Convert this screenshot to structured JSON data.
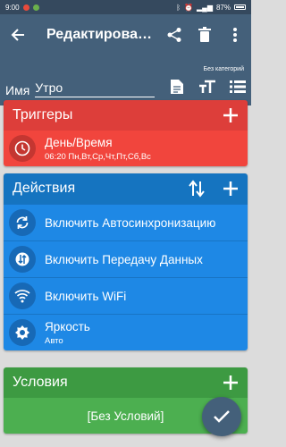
{
  "status": {
    "time": "9:00",
    "battery": "87%"
  },
  "toolbar": {
    "title": "Редактировать макрос"
  },
  "header": {
    "name_label": "Имя",
    "name_value": "Утро",
    "category_label": "Без категорий"
  },
  "triggers": {
    "title": "Триггеры",
    "items": [
      {
        "title": "День/Время",
        "subtitle": "06:20 Пн,Вт,Ср,Чт,Пт,Сб,Вс",
        "icon": "clock-icon"
      }
    ]
  },
  "actions": {
    "title": "Действия",
    "items": [
      {
        "title": "Включить Автосинхронизацию",
        "icon": "sync-icon"
      },
      {
        "title": "Включить Передачу Данных",
        "icon": "data-transfer-icon"
      },
      {
        "title": "Включить WiFi",
        "icon": "wifi-icon"
      },
      {
        "title": "Яркость",
        "subtitle": "Авто",
        "icon": "brightness-icon"
      }
    ]
  },
  "conditions": {
    "title": "Условия",
    "empty_text": "[Без Условий]"
  },
  "colors": {
    "toolbar": "#44607a",
    "triggers": "#f1453d",
    "actions": "#1e88e5",
    "conditions": "#4caf50"
  }
}
